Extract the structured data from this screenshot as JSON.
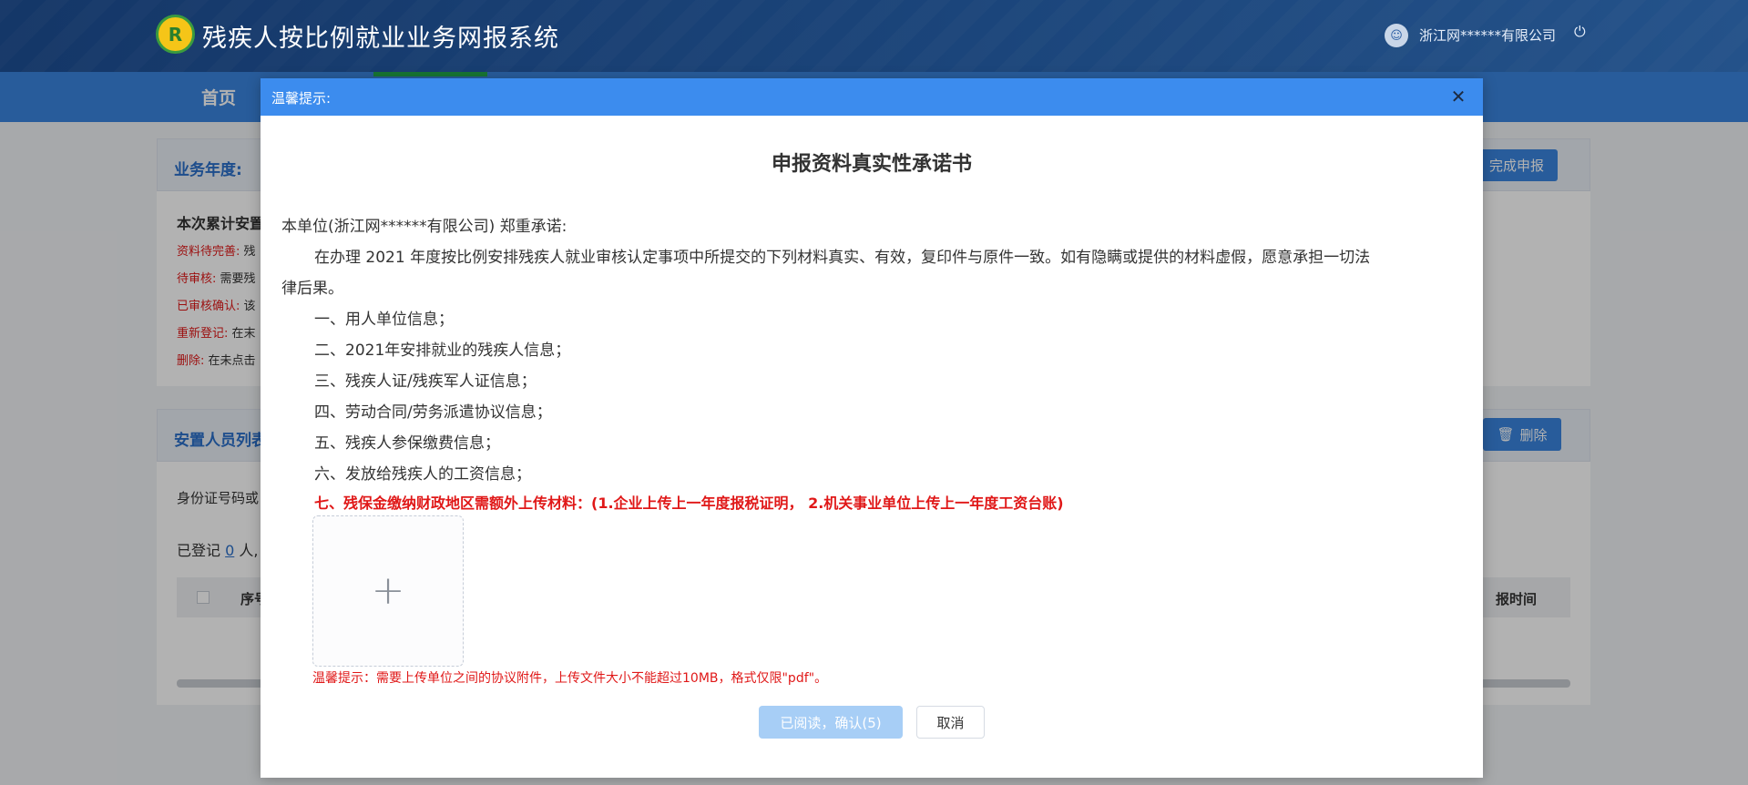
{
  "header": {
    "logo_char": "R",
    "system_title": "残疾人按比例就业业务网报系统",
    "user_name": "浙江网******有限公司"
  },
  "nav": {
    "home": "首页"
  },
  "background": {
    "business_year_label": "业务年度:",
    "complete_button": "完成申报",
    "summary_title": "本次累计安置",
    "legend": [
      {
        "label": "资料待完善:",
        "text": "残"
      },
      {
        "label": "待审核:",
        "text": "需要残"
      },
      {
        "label": "已审核确认:",
        "text": "该"
      },
      {
        "label": "重新登记:",
        "text": "在末"
      },
      {
        "label": "删除:",
        "text": "在未点击"
      }
    ],
    "list_title": "安置人员列表",
    "delete_button": "删除",
    "id_filter_label": "身份证号码或",
    "registered_prefix": "已登记",
    "registered_count": "0",
    "registered_suffix": "人,",
    "col_seq": "序号",
    "col_time": "报时间"
  },
  "modal": {
    "title": "温馨提示:",
    "doc_title": "申报资料真实性承诺书",
    "intro": "本单位(浙江网******有限公司) 郑重承诺:",
    "para1": "在办理 2021 年度按比例安排残疾人就业审核认定事项中所提交的下列材料真实、有效，复印件与原件一致。如有隐瞒或提供的材料虚假，愿意承担一切法",
    "para1_cont": "律后果。",
    "items": [
      "一、用人单位信息；",
      "二、2021年安排就业的残疾人信息；",
      "三、残疾人证/残疾军人证信息；",
      "四、劳动合同/劳务派遣协议信息；",
      "五、残疾人参保缴费信息；",
      "六、发放给残疾人的工资信息；"
    ],
    "item7": "七、残保金缴纳财政地区需额外上传材料：(1.企业上传上一年度报税证明， 2.机关事业单位上传上一年度工资台账)",
    "tip": "温馨提示：需要上传单位之间的协议附件，上传文件大小不能超过10MB，格式仅限\"pdf\"。",
    "confirm_button": "已阅读，确认(5)",
    "cancel_button": "取消"
  },
  "colors": {
    "primary": "#3a85de",
    "modal_header": "#3c8cee",
    "warning_red": "#e01818",
    "disabled_button": "#a7cef6"
  }
}
